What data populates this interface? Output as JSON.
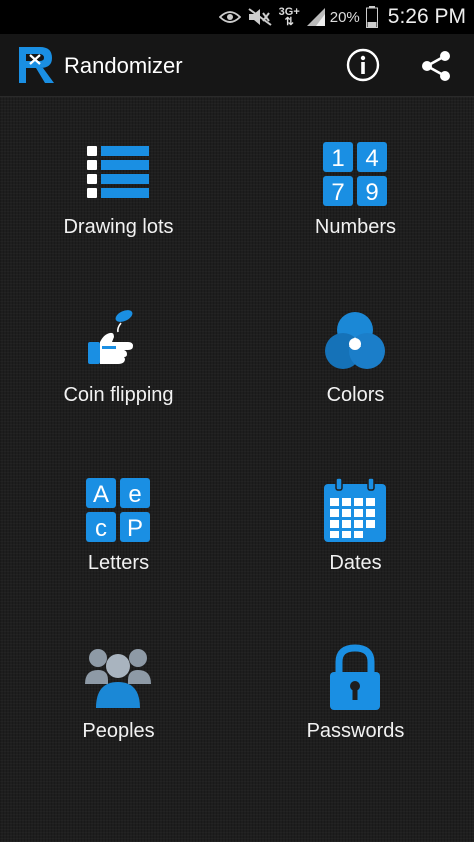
{
  "status_bar": {
    "network": "3G+",
    "battery": "20%",
    "time": "5:26 PM",
    "icons": [
      "eye-icon",
      "mute-icon",
      "network-arrows-icon",
      "signal-icon",
      "battery-icon"
    ]
  },
  "action_bar": {
    "title": "Randomizer",
    "logo_letter": "R",
    "actions": [
      "info-icon",
      "share-icon"
    ]
  },
  "colors": {
    "accent": "#1a8fe3",
    "icon_blue": "#1b88d6",
    "people_gray": "#8e9aa6",
    "background": "#1e1e1e"
  },
  "menu": {
    "drawing_lots": "Drawing lots",
    "numbers": "Numbers",
    "numbers_digits": [
      "1",
      "4",
      "7",
      "9"
    ],
    "coin_flipping": "Coin flipping",
    "colors": "Colors",
    "letters": "Letters",
    "letters_glyphs": [
      "A",
      "e",
      "c",
      "P"
    ],
    "dates": "Dates",
    "peoples": "Peoples",
    "passwords": "Passwords"
  }
}
